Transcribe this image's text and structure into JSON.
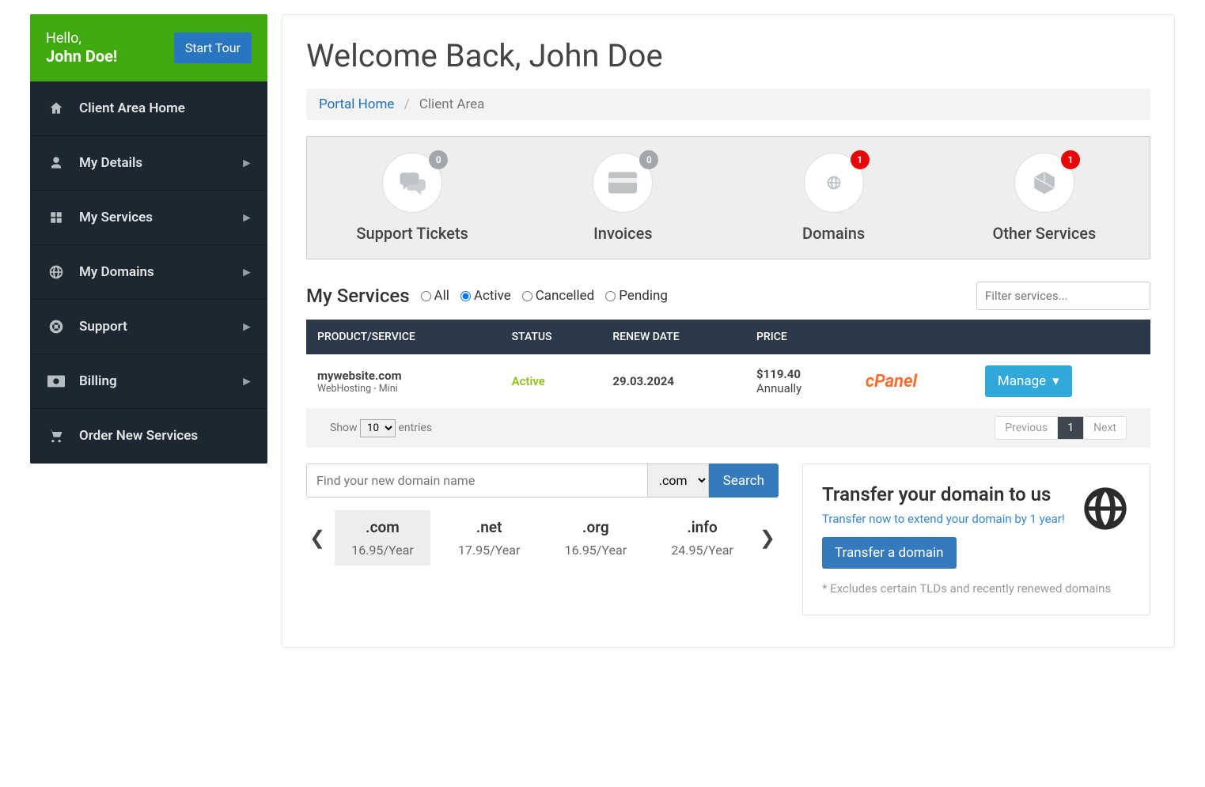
{
  "header": {
    "greeting": "Hello,",
    "username": "John Doe!",
    "tour_btn": "Start Tour"
  },
  "sidebar": {
    "items": [
      {
        "icon": "home",
        "label": "Client Area Home",
        "expand": false
      },
      {
        "icon": "user",
        "label": "My Details",
        "expand": true
      },
      {
        "icon": "grid",
        "label": "My Services",
        "expand": true
      },
      {
        "icon": "globe",
        "label": "My Domains",
        "expand": true
      },
      {
        "icon": "life-ring",
        "label": "Support",
        "expand": true
      },
      {
        "icon": "money",
        "label": "Billing",
        "expand": true
      },
      {
        "icon": "cart",
        "label": "Order New Services",
        "expand": false
      }
    ]
  },
  "page_title": "Welcome Back, John Doe",
  "breadcrumb": {
    "home": "Portal Home",
    "current": "Client Area"
  },
  "stats": [
    {
      "icon": "chat",
      "label": "Support Tickets",
      "count": "0",
      "style": "gray"
    },
    {
      "icon": "card",
      "label": "Invoices",
      "count": "0",
      "style": "gray"
    },
    {
      "icon": "globe",
      "label": "Domains",
      "count": "1",
      "style": "red"
    },
    {
      "icon": "cube",
      "label": "Other Services",
      "count": "1",
      "style": "red"
    }
  ],
  "services": {
    "title": "My Services",
    "filters": [
      "All",
      "Active",
      "Cancelled",
      "Pending"
    ],
    "selected_filter": "Active",
    "filter_placeholder": "Filter services...",
    "columns": [
      "PRODUCT/SERVICE",
      "STATUS",
      "RENEW DATE",
      "PRICE",
      "",
      ""
    ],
    "rows": [
      {
        "product": "mywebsite.com",
        "plan": "WebHosting - Mini",
        "status": "Active",
        "renew": "29.03.2024",
        "price": "$119.40",
        "period": "Annually",
        "panel": "cPanel",
        "action": "Manage"
      }
    ],
    "show_label": "Show",
    "entries_label": "entries",
    "per_page": "10",
    "pagination": {
      "prev": "Previous",
      "pages": [
        "1"
      ],
      "next": "Next"
    }
  },
  "domain_search": {
    "placeholder": "Find your new domain name",
    "tld_selected": ".com",
    "search_btn": "Search",
    "tlds": [
      {
        "ext": ".com",
        "price": "16.95/Year"
      },
      {
        "ext": ".net",
        "price": "17.95/Year"
      },
      {
        "ext": ".org",
        "price": "16.95/Year"
      },
      {
        "ext": ".info",
        "price": "24.95/Year"
      }
    ]
  },
  "transfer": {
    "title": "Transfer your domain to us",
    "link": "Transfer now to extend your domain by 1 year!",
    "button": "Transfer a domain",
    "note": "* Excludes certain TLDs and recently renewed domains"
  }
}
